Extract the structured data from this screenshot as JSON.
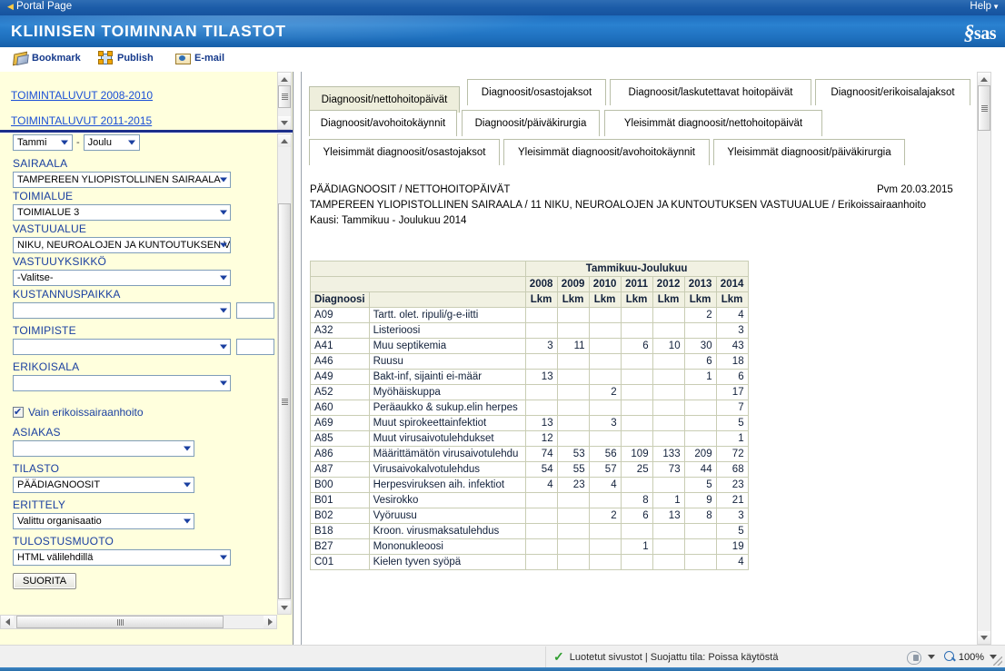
{
  "portal": {
    "back_label": "Portal Page",
    "help_label": "Help",
    "brand": "sas"
  },
  "header": {
    "title": "KLIINISEN TOIMINNAN TILASTOT"
  },
  "toolbar": {
    "items": [
      {
        "label": "Bookmark",
        "icon": "bookmark-icon"
      },
      {
        "label": "Publish",
        "icon": "publish-icon"
      },
      {
        "label": "E-mail",
        "icon": "email-icon"
      }
    ]
  },
  "sidebar": {
    "links": [
      {
        "label": "TOIMINTALUVUT 2008-2010"
      },
      {
        "label": "TOIMINTALUVUT 2011-2015"
      }
    ],
    "month_from": "Tammi",
    "month_sep": "-",
    "month_to": "Joulu",
    "fields": [
      {
        "label": "SAIRAALA",
        "value": "TAMPEREEN YLIOPISTOLLINEN SAIRAALA"
      },
      {
        "label": "TOIMIALUE",
        "value": "TOIMIALUE 3"
      },
      {
        "label": "VASTUUALUE",
        "value": "NIKU, NEUROALOJEN JA KUNTOUTUKSEN V"
      },
      {
        "label": "VASTUUYKSIKKÖ",
        "value": "-Valitse-"
      },
      {
        "label": "KUSTANNUSPAIKKA",
        "value": ""
      },
      {
        "label": "TOIMIPISTE",
        "value": ""
      },
      {
        "label": "ERIKOISALA",
        "value": ""
      },
      {
        "label": "ASIAKAS",
        "value": ""
      },
      {
        "label": "TILASTO",
        "value": "PÄÄDIAGNOOSIT"
      },
      {
        "label": "ERITTELY",
        "value": "Valittu organisaatio"
      },
      {
        "label": "TULOSTUSMUOTO",
        "value": "HTML välilehdillä"
      }
    ],
    "checkbox": {
      "label": "Vain erikoissairaanhoito",
      "checked": true
    },
    "submit_label": "SUORITA"
  },
  "tabs": [
    {
      "label": "Diagnoosit/nettohoitopäivät",
      "active": true
    },
    {
      "label": "Diagnoosit/osastojaksot",
      "active": false
    },
    {
      "label": "Diagnoosit/laskutettavat hoitopäivät",
      "active": false
    },
    {
      "label": "Diagnoosit/erikoisalajaksot",
      "active": false
    },
    {
      "label": "Diagnoosit/avohoitokäynnit",
      "active": false
    },
    {
      "label": "Diagnoosit/päiväkirurgia",
      "active": false
    },
    {
      "label": "Yleisimmät diagnoosit/nettohoitopäivät",
      "active": false
    },
    {
      "label": "Yleisimmät diagnoosit/osastojaksot",
      "active": false
    },
    {
      "label": "Yleisimmät diagnoosit/avohoitokäynnit",
      "active": false
    },
    {
      "label": "Yleisimmät diagnoosit/päiväkirurgia",
      "active": false
    }
  ],
  "report": {
    "title": "PÄÄDIAGNOOSIT / NETTOHOITOPÄIVÄT",
    "date": "Pvm 20.03.2015",
    "org": "TAMPEREEN YLIOPISTOLLINEN SAIRAALA / 11 NIKU, NEUROALOJEN JA KUNTOUTUKSEN VASTUUALUE / Erikoissairaanhoito",
    "period": "Kausi: Tammikuu - Joulukuu 2014"
  },
  "chart_data": {
    "type": "table",
    "title": "PÄÄDIAGNOOSIT / NETTOHOITOPÄIVÄT",
    "span_header": "Tammikuu-Joulukuu",
    "years": [
      "2008",
      "2009",
      "2010",
      "2011",
      "2012",
      "2013",
      "2014"
    ],
    "unit_row": [
      "Lkm",
      "Lkm",
      "Lkm",
      "Lkm",
      "Lkm",
      "Lkm",
      "Lkm"
    ],
    "col_code_header": "Diagnoosi",
    "col_name_header": "",
    "rows": [
      {
        "code": "A09",
        "name": "Tartt. olet. ripuli/g-e-iitti",
        "values": [
          "",
          "",
          "",
          "",
          "",
          "2",
          "4"
        ]
      },
      {
        "code": "A32",
        "name": "Listerioosi",
        "values": [
          "",
          "",
          "",
          "",
          "",
          "",
          "3"
        ]
      },
      {
        "code": "A41",
        "name": "Muu septikemia",
        "values": [
          "3",
          "11",
          "",
          "6",
          "10",
          "30",
          "43"
        ]
      },
      {
        "code": "A46",
        "name": "Ruusu",
        "values": [
          "",
          "",
          "",
          "",
          "",
          "6",
          "18"
        ]
      },
      {
        "code": "A49",
        "name": "Bakt-inf, sijainti ei-määr",
        "values": [
          "13",
          "",
          "",
          "",
          "",
          "1",
          "6"
        ]
      },
      {
        "code": "A52",
        "name": "Myöhäiskuppa",
        "values": [
          "",
          "",
          "2",
          "",
          "",
          "",
          "17"
        ]
      },
      {
        "code": "A60",
        "name": "Peräaukko & sukup.elin herpes",
        "values": [
          "",
          "",
          "",
          "",
          "",
          "",
          "7"
        ]
      },
      {
        "code": "A69",
        "name": "Muut spirokeettainfektiot",
        "values": [
          "13",
          "",
          "3",
          "",
          "",
          "",
          "5"
        ]
      },
      {
        "code": "A85",
        "name": "Muut virusaivotulehdukset",
        "values": [
          "12",
          "",
          "",
          "",
          "",
          "",
          "1"
        ]
      },
      {
        "code": "A86",
        "name": "Määrittämätön virusaivotulehdu",
        "values": [
          "74",
          "53",
          "56",
          "109",
          "133",
          "209",
          "72"
        ]
      },
      {
        "code": "A87",
        "name": "Virusaivokalvotulehdus",
        "values": [
          "54",
          "55",
          "57",
          "25",
          "73",
          "44",
          "68"
        ]
      },
      {
        "code": "B00",
        "name": "Herpesviruksen aih. infektiot",
        "values": [
          "4",
          "23",
          "4",
          "",
          "",
          "5",
          "23"
        ]
      },
      {
        "code": "B01",
        "name": "Vesirokko",
        "values": [
          "",
          "",
          "",
          "8",
          "1",
          "9",
          "21"
        ]
      },
      {
        "code": "B02",
        "name": "Vyöruusu",
        "values": [
          "",
          "",
          "2",
          "6",
          "13",
          "8",
          "3"
        ]
      },
      {
        "code": "B18",
        "name": "Kroon. virusmaksatulehdus",
        "values": [
          "",
          "",
          "",
          "",
          "",
          "",
          "5"
        ]
      },
      {
        "code": "B27",
        "name": "Mononukleoosi",
        "values": [
          "",
          "",
          "",
          "1",
          "",
          "",
          "19"
        ]
      },
      {
        "code": "C01",
        "name": "Kielen tyven syöpä",
        "values": [
          "",
          "",
          "",
          "",
          "",
          "",
          "4"
        ]
      }
    ]
  },
  "statusbar": {
    "zone_text": "Luotetut sivustot | Suojattu tila: Poissa käytöstä",
    "zoom": "100%"
  }
}
